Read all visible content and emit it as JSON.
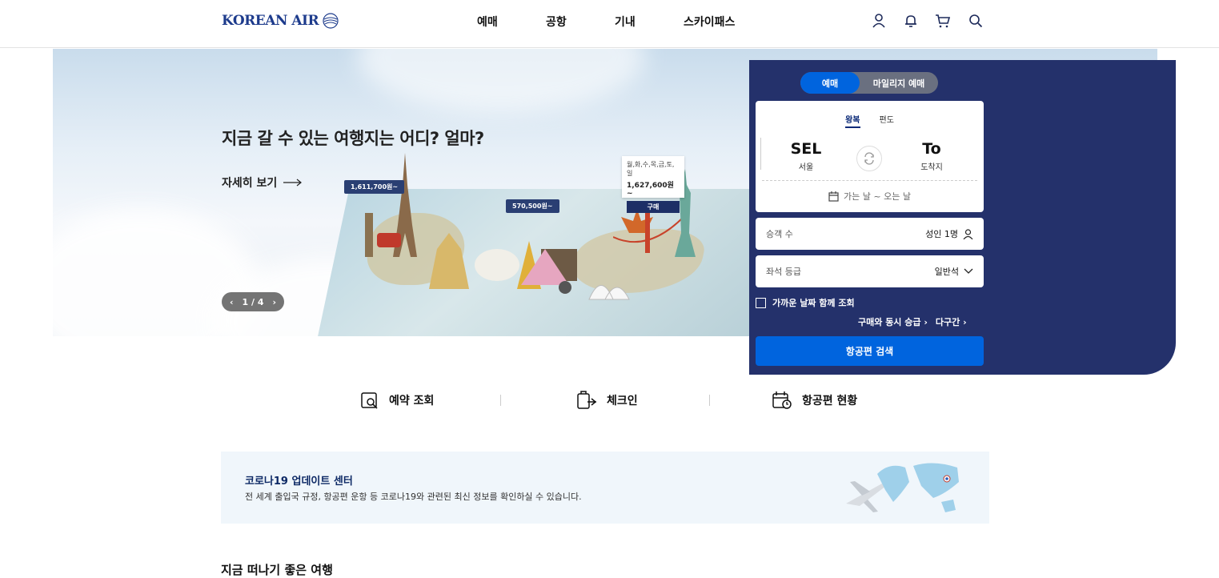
{
  "header": {
    "logo_text": "KOREAN AIR",
    "nav": [
      "예매",
      "공항",
      "기내",
      "스카이패스"
    ],
    "icons": [
      "user-icon",
      "bell-icon",
      "cart-icon",
      "search-icon"
    ]
  },
  "hero": {
    "title": "지금 갈 수 있는 여행지는 어디? 얼마?",
    "more_label": "자세히 보기",
    "pager": "1 / 4",
    "price_tags": [
      "1,611,700원~",
      "570,500원~"
    ],
    "price_card": {
      "days": "월,화,수,목,금,토,일",
      "price": "1,627,600원~",
      "button": "구매"
    }
  },
  "booking": {
    "segments": [
      "예매",
      "마일리지 예매"
    ],
    "trip_tabs": [
      "왕복",
      "편도"
    ],
    "origin": {
      "code": "SEL",
      "city": "서울"
    },
    "destination": {
      "code": "To",
      "city": "도착지"
    },
    "date_placeholder": "가는 날 ~ 오는 날",
    "passengers_label": "승객 수",
    "passengers_value": "성인 1명",
    "cabin_label": "좌석 등급",
    "cabin_value": "일반석",
    "flex_dates_label": "가까운 날짜 함께 조회",
    "links": [
      "구매와 동시 승급",
      "다구간"
    ],
    "search_button": "항공편 검색"
  },
  "quick_menu": [
    "예약 조회",
    "체크인",
    "항공편 현황"
  ],
  "covid": {
    "title": "코로나19 업데이트 센터",
    "description": "전 세계 출입국 규정, 항공편 운항 등 코로나19와 관련된 최신 정보를 확인하실 수 있습니다."
  },
  "section_title": "지금 떠나기 좋은 여행",
  "colors": {
    "brand_navy": "#24316b",
    "accent_blue": "#0064de",
    "logo_blue": "#1d3b8c"
  }
}
